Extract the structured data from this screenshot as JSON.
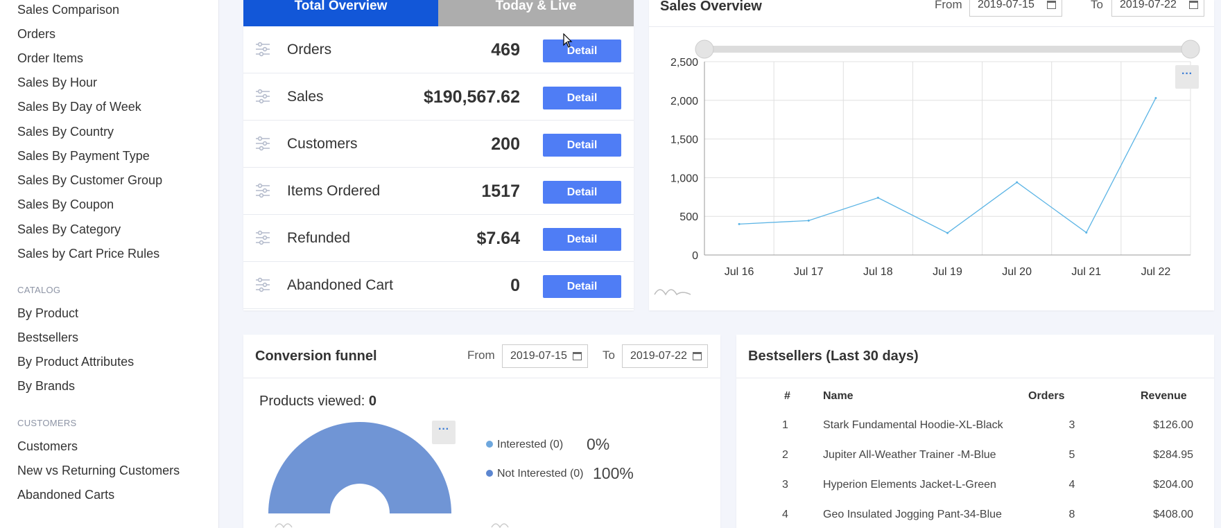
{
  "sidebar": {
    "items_top": [
      "Sales Comparison",
      "Orders",
      "Order Items",
      "Sales By Hour",
      "Sales By Day of Week",
      "Sales By Country",
      "Sales By Payment Type",
      "Sales By Customer Group",
      "Sales By Coupon",
      "Sales By Category",
      "Sales by Cart Price Rules"
    ],
    "catalog_heading": "CATALOG",
    "catalog_items": [
      "By Product",
      "Bestsellers",
      "By Product Attributes",
      "By Brands"
    ],
    "customers_heading": "CUSTOMERS",
    "customers_items": [
      "Customers",
      "New vs Returning Customers",
      "Abandoned Carts"
    ]
  },
  "overview": {
    "tab_total": "Total Overview",
    "tab_live": "Today & Live",
    "detail_label": "Detail",
    "rows": [
      {
        "label": "Orders",
        "value": "469"
      },
      {
        "label": "Sales",
        "value": "$190,567.62"
      },
      {
        "label": "Customers",
        "value": "200"
      },
      {
        "label": "Items Ordered",
        "value": "1517"
      },
      {
        "label": "Refunded",
        "value": "$7.64"
      },
      {
        "label": "Abandoned Cart",
        "value": "0"
      }
    ]
  },
  "sales_overview": {
    "title": "Sales Overview",
    "from_label": "From",
    "from_value": "2019-07-15",
    "to_label": "To",
    "to_value": "2019-07-22",
    "menu_glyph": "···"
  },
  "chart_data": {
    "type": "line",
    "categories": [
      "Jul 16",
      "Jul 17",
      "Jul 18",
      "Jul 19",
      "Jul 20",
      "Jul 21",
      "Jul 22"
    ],
    "series": [
      {
        "values": [
          400,
          445,
          740,
          285,
          940,
          290,
          2030
        ]
      }
    ],
    "yticks": [
      "0",
      "500",
      "1,000",
      "1,500",
      "2,000",
      "2,500"
    ],
    "ylim": [
      0,
      2500
    ],
    "grid": true,
    "color": "#5bb4e5"
  },
  "funnel": {
    "title": "Conversion funnel",
    "from_label": "From",
    "from_value": "2019-07-15",
    "to_label": "To",
    "to_value": "2019-07-22",
    "products_viewed_label": "Products viewed:",
    "products_viewed_value": "0",
    "legend": [
      {
        "label": "Interested (0)",
        "pct": "0%",
        "color": "#6ea7dd"
      },
      {
        "label": "Not Interested (0)",
        "pct": "100%",
        "color": "#5c86d0"
      }
    ],
    "menu_glyph": "···",
    "donut_color": "#7095d5"
  },
  "bestsellers": {
    "title": "Bestsellers (Last 30 days)",
    "headers": {
      "num": "#",
      "name": "Name",
      "orders": "Orders",
      "revenue": "Revenue"
    },
    "rows": [
      {
        "num": "1",
        "name": "Stark Fundamental Hoodie-XL-Black",
        "orders": "3",
        "revenue": "$126.00"
      },
      {
        "num": "2",
        "name": "Jupiter All-Weather Trainer -M-Blue",
        "orders": "5",
        "revenue": "$284.95"
      },
      {
        "num": "3",
        "name": "Hyperion Elements Jacket-L-Green",
        "orders": "4",
        "revenue": "$204.00"
      },
      {
        "num": "4",
        "name": "Geo Insulated Jogging Pant-34-Blue",
        "orders": "8",
        "revenue": "$408.00"
      }
    ]
  }
}
